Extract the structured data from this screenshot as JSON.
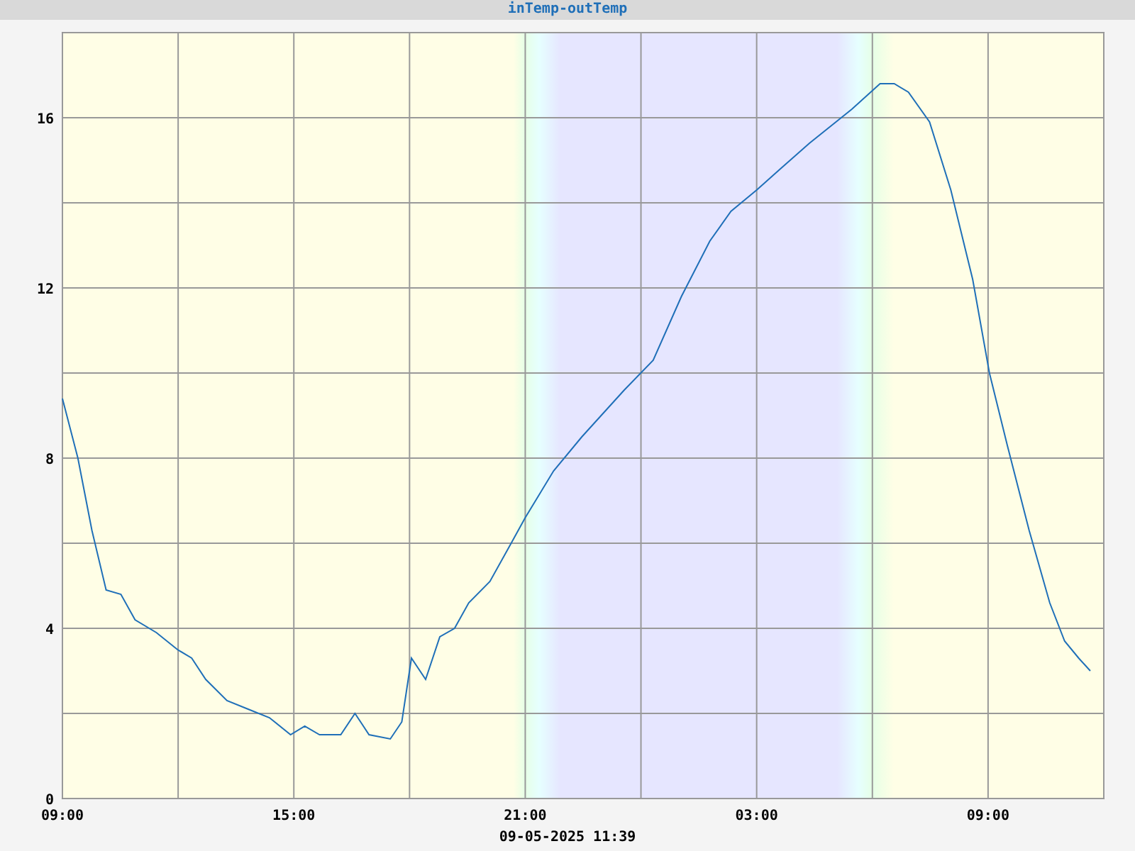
{
  "chart": {
    "chart_data": {
      "type": "line",
      "xlim": [
        "2025-05-08T09:00",
        "2025-05-09T12:00"
      ],
      "ylim": [
        0,
        18
      ],
      "xticks": [
        {
          "value": "2025-05-08T09:00",
          "label": "09:00"
        },
        {
          "value": "2025-05-08T15:00",
          "label": "15:00"
        },
        {
          "value": "2025-05-08T21:00",
          "label": "21:00"
        },
        {
          "value": "2025-05-09T03:00",
          "label": "03:00"
        },
        {
          "value": "2025-05-09T09:00",
          "label": "09:00"
        }
      ],
      "yticks": [
        0,
        4,
        8,
        12,
        16
      ],
      "grid": true,
      "x": [
        "2025-05-08T09:00",
        "2025-05-08T09:24",
        "2025-05-08T09:46",
        "2025-05-08T10:08",
        "2025-05-08T10:31",
        "2025-05-08T10:53",
        "2025-05-08T11:26",
        "2025-05-08T11:59",
        "2025-05-08T12:21",
        "2025-05-08T12:43",
        "2025-05-08T13:16",
        "2025-05-08T13:49",
        "2025-05-08T14:22",
        "2025-05-08T14:55",
        "2025-05-08T15:17",
        "2025-05-08T15:40",
        "2025-05-08T16:13",
        "2025-05-08T16:35",
        "2025-05-08T16:57",
        "2025-05-08T17:30",
        "2025-05-08T17:48",
        "2025-05-08T18:03",
        "2025-05-08T18:25",
        "2025-05-08T18:47",
        "2025-05-08T19:10",
        "2025-05-08T19:32",
        "2025-05-08T20:05",
        "2025-05-08T20:38",
        "2025-05-08T21:00",
        "2025-05-08T21:44",
        "2025-05-08T22:28",
        "2025-05-08T23:34",
        "2025-05-09T00:19",
        "2025-05-09T01:03",
        "2025-05-09T01:47",
        "2025-05-09T02:20",
        "2025-05-09T03:00",
        "2025-05-09T03:37",
        "2025-05-09T04:22",
        "2025-05-09T05:28",
        "2025-05-09T06:12",
        "2025-05-09T06:34",
        "2025-05-09T06:56",
        "2025-05-09T07:29",
        "2025-05-09T08:02",
        "2025-05-09T08:36",
        "2025-05-09T09:02",
        "2025-05-09T09:30",
        "2025-05-09T10:04",
        "2025-05-09T10:36",
        "2025-05-09T10:59",
        "2025-05-09T11:21",
        "2025-05-09T11:39"
      ],
      "series": [
        {
          "name": "inTemp-outTemp",
          "color": "#1f6fb8",
          "values": [
            9.4,
            8.0,
            6.3,
            4.9,
            4.8,
            4.2,
            3.9,
            3.5,
            3.3,
            2.8,
            2.3,
            2.1,
            1.9,
            1.5,
            1.7,
            1.5,
            1.5,
            2.0,
            1.5,
            1.4,
            1.8,
            3.3,
            2.8,
            3.8,
            4.0,
            4.6,
            5.1,
            6.0,
            6.6,
            7.7,
            8.5,
            9.6,
            10.3,
            11.8,
            13.1,
            13.8,
            14.3,
            14.8,
            15.4,
            16.2,
            16.8,
            16.8,
            16.6,
            15.9,
            14.3,
            12.2,
            10.0,
            8.3,
            6.3,
            4.6,
            3.7,
            3.3,
            3.0
          ]
        }
      ]
    }
  },
  "timestamp": "09-05-2025 11:39"
}
